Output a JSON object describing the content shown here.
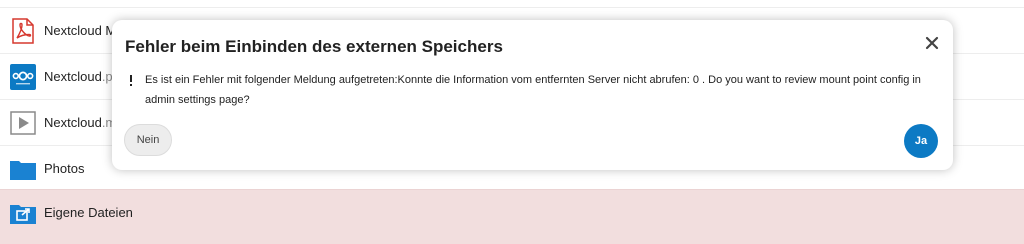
{
  "files": [
    {
      "name": "Nextcloud Ma",
      "ext": "",
      "icon": "pdf-icon"
    },
    {
      "name": "Nextcloud",
      "ext": ".pn",
      "icon": "nextcloud-logo-icon"
    },
    {
      "name": "Nextcloud",
      "ext": ".mp",
      "icon": "video-icon"
    },
    {
      "name": "Photos",
      "ext": "",
      "icon": "folder-icon"
    },
    {
      "name": "Eigene Dateien",
      "ext": "",
      "icon": "external-folder-icon"
    }
  ],
  "dialog": {
    "title": "Fehler beim Einbinden des externen Speichers",
    "message": "Es ist ein Fehler mit folgender Meldung aufgetreten:Konnte die Information vom entfernten Server nicht abrufen: 0 . Do you want to review mount point config in admin settings page?",
    "no_label": "Nein",
    "yes_label": "Ja",
    "close_icon": "close-icon",
    "warning_icon": "exclamation-icon"
  },
  "colors": {
    "primary": "#0c7ac4",
    "highlight_row": "#f2dede",
    "folder": "#1a82d2",
    "pdf": "#d6382f"
  }
}
